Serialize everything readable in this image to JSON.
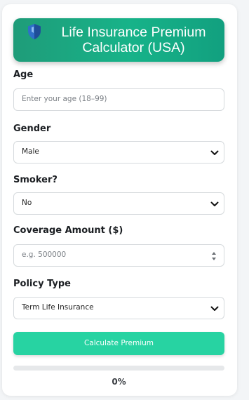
{
  "header": {
    "title": "Life Insurance Premium Calculator (USA)",
    "icon": "shield-icon"
  },
  "form": {
    "age": {
      "label": "Age",
      "value": "",
      "placeholder": "Enter your age (18–99)"
    },
    "gender": {
      "label": "Gender",
      "selected": "Male"
    },
    "smoker": {
      "label": "Smoker?",
      "selected": "No"
    },
    "coverage": {
      "label": "Coverage Amount ($)",
      "value": "",
      "placeholder": "e.g. 500000"
    },
    "policy_type": {
      "label": "Policy Type",
      "selected": "Term Life Insurance"
    }
  },
  "actions": {
    "calculate_label": "Calculate Premium"
  },
  "progress": {
    "value": 0,
    "text": "0%"
  },
  "colors": {
    "accent": "#27d3a2",
    "header_start": "#1f9c79",
    "header_end": "#12a07f"
  }
}
